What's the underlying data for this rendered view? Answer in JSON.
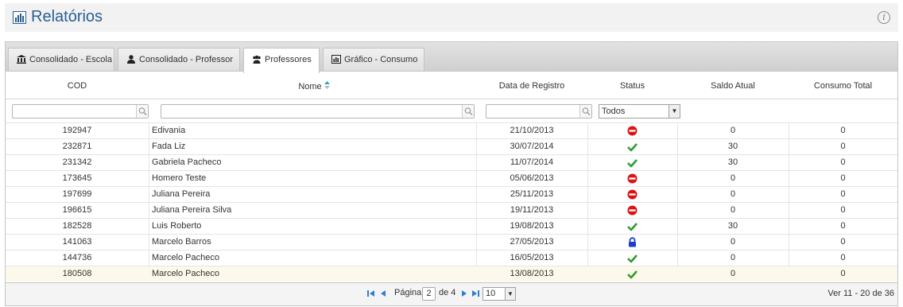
{
  "page": {
    "title": "Relatórios"
  },
  "tabs": [
    {
      "label": "Consolidado - Escola",
      "icon": "bank-icon"
    },
    {
      "label": "Consolidado - Professor",
      "icon": "user-icon"
    },
    {
      "label": "Professores",
      "icon": "users-icon",
      "active": true
    },
    {
      "label": "Gráfico - Consumo",
      "icon": "bar-chart-icon"
    }
  ],
  "table": {
    "headers": {
      "cod": "COD",
      "nome": "Nome",
      "data": "Data de Registro",
      "status": "Status",
      "saldo": "Saldo Atual",
      "consumo": "Consumo Total"
    },
    "status_filter": "Todos",
    "rows": [
      {
        "cod": "192947",
        "nome": "Edivania",
        "data": "21/10/2013",
        "status": "inactive",
        "saldo": "0",
        "consumo": "0"
      },
      {
        "cod": "232871",
        "nome": "Fada Liz",
        "data": "30/07/2014",
        "status": "active",
        "saldo": "30",
        "consumo": "0"
      },
      {
        "cod": "231342",
        "nome": "Gabriela Pacheco",
        "data": "11/07/2014",
        "status": "active",
        "saldo": "30",
        "consumo": "0"
      },
      {
        "cod": "173645",
        "nome": "Homero Teste",
        "data": "05/06/2013",
        "status": "inactive",
        "saldo": "0",
        "consumo": "0"
      },
      {
        "cod": "197699",
        "nome": "Juliana Pereira",
        "data": "25/11/2013",
        "status": "inactive",
        "saldo": "0",
        "consumo": "0"
      },
      {
        "cod": "196615",
        "nome": "Juliana Pereira Silva",
        "data": "19/11/2013",
        "status": "inactive",
        "saldo": "0",
        "consumo": "0"
      },
      {
        "cod": "182528",
        "nome": "Luis Roberto",
        "data": "19/08/2013",
        "status": "active",
        "saldo": "30",
        "consumo": "0"
      },
      {
        "cod": "141063",
        "nome": "Marcelo Barros",
        "data": "27/05/2013",
        "status": "locked",
        "saldo": "0",
        "consumo": "0"
      },
      {
        "cod": "144736",
        "nome": "Marcelo Pacheco",
        "data": "16/05/2013",
        "status": "active",
        "saldo": "0",
        "consumo": "0"
      },
      {
        "cod": "180508",
        "nome": "Marcelo Pacheco",
        "data": "13/08/2013",
        "status": "active",
        "saldo": "0",
        "consumo": "0"
      }
    ]
  },
  "pager": {
    "page_label": "Página",
    "current_page": "2",
    "of_label": "de 4",
    "page_size": "10",
    "summary": "Ver 11 - 20 de 36"
  },
  "colors": {
    "title": "#2a5f94",
    "active": "#2e9e2e",
    "inactive": "#e01010",
    "locked": "#1a3cd6",
    "pager_icon": "#2f7fd0"
  }
}
